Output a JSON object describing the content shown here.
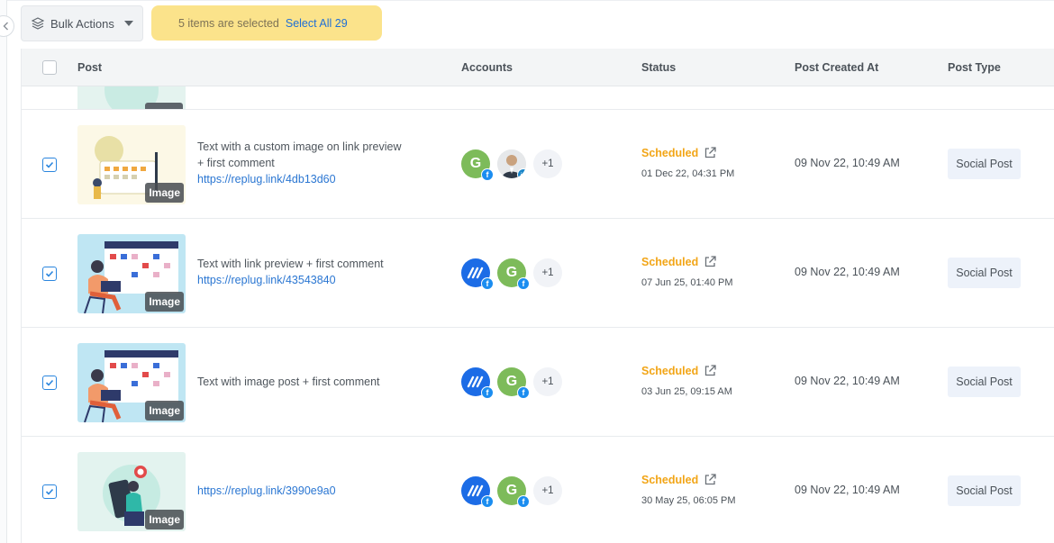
{
  "toolbar": {
    "bulk_actions_label": "Bulk Actions",
    "selection_text": "5 items are selected",
    "select_all_label": "Select All 29"
  },
  "table": {
    "columns": [
      "Post",
      "Accounts",
      "Status",
      "Post Created At",
      "Post Type"
    ]
  },
  "rows": [
    {
      "checked": true,
      "thumbnail_badge": "Image",
      "text_line1": "Text with a custom image on link preview",
      "text_line2": "+ first comment",
      "link": "https://replug.link/4db13d60",
      "accounts": [
        {
          "avatar": "G",
          "network": "facebook-icon"
        },
        {
          "avatar": "person-photo",
          "network": "linkedin-icon"
        }
      ],
      "more_accounts": "+1",
      "status": "Scheduled",
      "scheduled_at": "01 Dec 22, 04:31 PM",
      "created_at": "09 Nov 22, 10:49 AM",
      "post_type": "Social Post"
    },
    {
      "checked": true,
      "thumbnail_badge": "Image",
      "text_line1": "Text with link preview + first comment",
      "link": "https://replug.link/43543840",
      "accounts": [
        {
          "avatar": "brand-logo",
          "network": "facebook-icon"
        },
        {
          "avatar": "G",
          "network": "facebook-icon"
        }
      ],
      "more_accounts": "+1",
      "status": "Scheduled",
      "scheduled_at": "07 Jun 25, 01:40 PM",
      "created_at": "09 Nov 22, 10:49 AM",
      "post_type": "Social Post"
    },
    {
      "checked": true,
      "thumbnail_badge": "Image",
      "text_line1": "Text with image post + first comment",
      "accounts": [
        {
          "avatar": "brand-logo",
          "network": "facebook-icon"
        },
        {
          "avatar": "G",
          "network": "facebook-icon"
        }
      ],
      "more_accounts": "+1",
      "status": "Scheduled",
      "scheduled_at": "03 Jun 25, 09:15 AM",
      "created_at": "09 Nov 22, 10:49 AM",
      "post_type": "Social Post"
    },
    {
      "checked": true,
      "thumbnail_badge": "Image",
      "link": "https://replug.link/3990e9a0",
      "accounts": [
        {
          "avatar": "brand-logo",
          "network": "facebook-icon"
        },
        {
          "avatar": "G",
          "network": "facebook-icon"
        }
      ],
      "more_accounts": "+1",
      "status": "Scheduled",
      "scheduled_at": "30 May 25, 06:05 PM",
      "created_at": "09 Nov 22, 10:49 AM",
      "post_type": "Social Post"
    }
  ],
  "colors": {
    "accent": "#2b86de",
    "status_scheduled": "#f2a516",
    "selection_banner": "#fbe38b",
    "link": "#2a76d2"
  }
}
